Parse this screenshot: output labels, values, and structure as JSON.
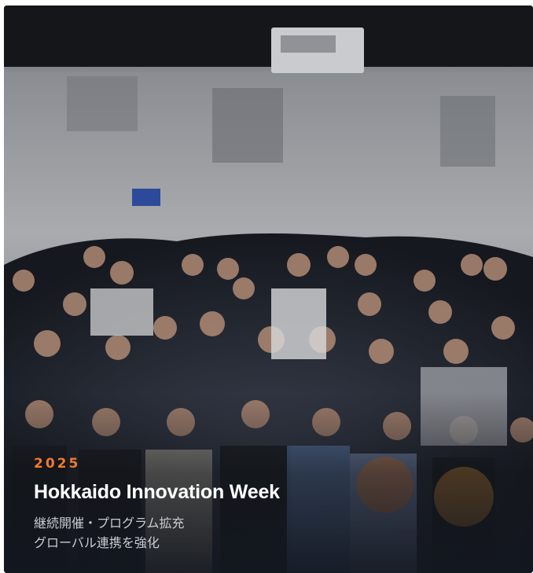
{
  "card": {
    "image_alt": "Group photo of event participants",
    "year": "2025",
    "title": "Hokkaido Innovation Week",
    "description_lines": [
      "継続開催・プログラム拡充",
      "グローバル連携を強化"
    ],
    "year_color": "#f07a2f"
  }
}
